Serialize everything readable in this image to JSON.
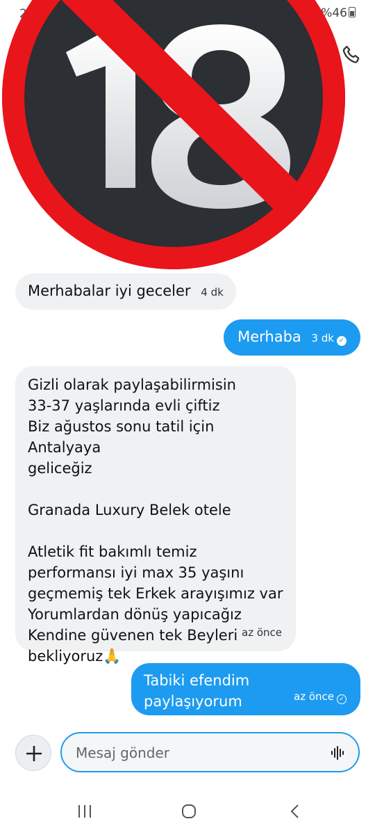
{
  "status": {
    "time": "2",
    "battery": "%46"
  },
  "header": {
    "call_icon": "phone-icon",
    "sticker_icon": "no-under-18-icon"
  },
  "messages": [
    {
      "dir": "in",
      "text": "Merhabalar iyi geceler",
      "time": "4 dk"
    },
    {
      "dir": "out",
      "text": "Merhaba",
      "time": "3 dk",
      "status_icon": "check-filled-icon"
    },
    {
      "dir": "in",
      "lines": [
        "Gizli olarak paylaşabilirmisin",
        "33-37 yaşlarında evli çiftiz",
        "Biz ağustos sonu tatil için Antalyaya",
        "geliceğiz",
        "",
        "Granada Luxury Belek  otele",
        "",
        "Atletik fit  bakımlı temiz",
        "performansı iyi  max 35 yaşını",
        "geçmemiş  tek Erkek arayışımız var",
        "Yorumlardan dönüş yapıcağız",
        "Kendine güvenen tek Beyleri",
        "bekliyoruz🙏"
      ],
      "time": "az önce"
    },
    {
      "dir": "out",
      "text": "Tabiki efendim paylaşıyorum",
      "time": "az önce",
      "status_icon": "check-outline-icon"
    }
  ],
  "composer": {
    "placeholder": "Mesaj gönder",
    "add_icon": "plus-icon",
    "voice_icon": "voice-wave-icon"
  },
  "nav": {
    "recents_icon": "recents-icon",
    "home_icon": "home-icon",
    "back_icon": "back-icon"
  },
  "colors": {
    "accent": "#1d9bf0",
    "incoming_bubble": "#eff1f3",
    "badge_red": "#e8151b"
  }
}
